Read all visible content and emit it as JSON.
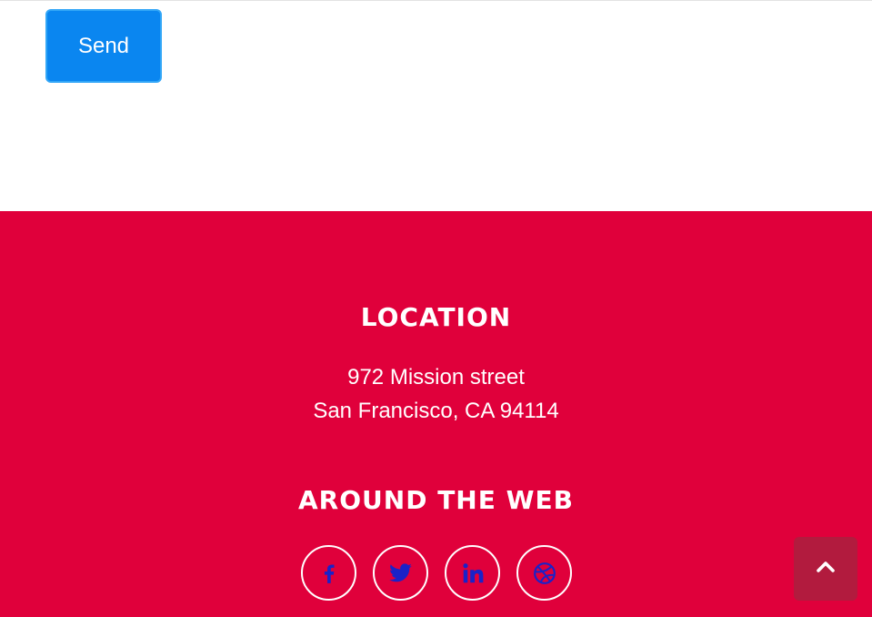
{
  "form": {
    "send_label": "Send"
  },
  "footer": {
    "location_heading": "LOCATION",
    "address_line_1": "972 Mission street",
    "address_line_2": "San Francisco, CA 94114",
    "web_heading": "AROUND THE WEB",
    "social_links": [
      {
        "icon": "facebook-icon"
      },
      {
        "icon": "twitter-icon"
      },
      {
        "icon": "linkedin-icon"
      },
      {
        "icon": "dribbble-icon"
      }
    ]
  },
  "scroll_top": {
    "icon": "chevron-up-icon"
  },
  "colors": {
    "footer_background": "#e0003b",
    "send_button": "#0a86f0",
    "social_icon": "#1a22c8",
    "scroll_top_button": "#b21b3e"
  }
}
